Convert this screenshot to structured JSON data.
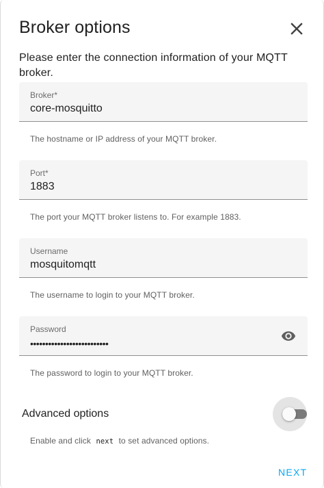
{
  "dialog": {
    "title": "Broker options",
    "close_icon": "close-icon",
    "intro": "Please enter the connection information of your MQTT broker."
  },
  "fields": {
    "broker": {
      "label": "Broker*",
      "value": "core-mosquitto",
      "helper": "The hostname or IP address of your MQTT broker."
    },
    "port": {
      "label": "Port*",
      "value": "1883",
      "helper": "The port your MQTT broker listens to. For example 1883."
    },
    "username": {
      "label": "Username",
      "value": "mosquitomqtt",
      "helper": "The username to login to your MQTT broker."
    },
    "password": {
      "label": "Password",
      "value": "••••••••••••••••••••••••••",
      "helper": "The password to login to your MQTT broker.",
      "toggle_icon": "eye-icon"
    }
  },
  "advanced": {
    "label": "Advanced options",
    "enabled": false,
    "helper_prefix": "Enable and click",
    "helper_code": "next",
    "helper_suffix": "to set advanced options."
  },
  "actions": {
    "next_label": "NEXT"
  },
  "colors": {
    "accent": "#03a9f4",
    "field_bg": "#f5f5f5",
    "text": "#212121",
    "helper_text": "#5f5f5f"
  }
}
